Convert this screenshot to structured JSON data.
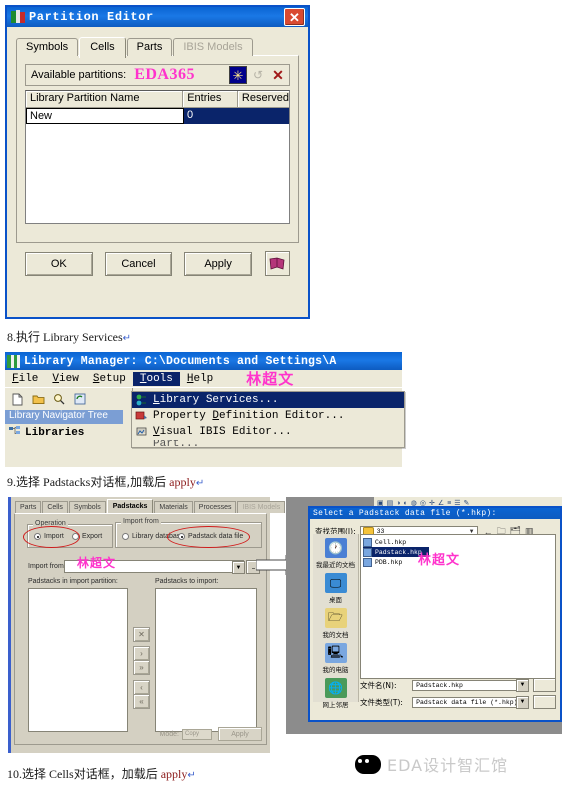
{
  "partition_editor": {
    "title": "Partition Editor",
    "app_icon": "partition-editor-icon",
    "close_label": "✕",
    "tabs": [
      {
        "label": "Symbols",
        "state": "normal"
      },
      {
        "label": "Cells",
        "state": "selected"
      },
      {
        "label": "Parts",
        "state": "normal"
      },
      {
        "label": "IBIS Models",
        "state": "disabled"
      }
    ],
    "available_partitions_label": "Available partitions:",
    "watermark": "EDA365",
    "toolbar": {
      "new_label": "✳",
      "undo_label": "↺",
      "delete_label": "✕"
    },
    "grid": {
      "columns": [
        "Library Partition Name",
        "Entries",
        "Reserved"
      ],
      "rows": [
        {
          "name": "New",
          "entries": "0",
          "reserved": ""
        }
      ]
    },
    "buttons": {
      "ok": "OK",
      "cancel": "Cancel",
      "apply": "Apply",
      "help": "help-book-icon"
    }
  },
  "step8": {
    "number": "8.",
    "cjk": "执行",
    "text": "Library Services",
    "mark": "↵"
  },
  "library_manager": {
    "title": "Library Manager: C:\\Documents and Settings\\A",
    "app_icon": "library-manager-icon",
    "menus": [
      {
        "label": "File",
        "accel": "F",
        "state": "normal"
      },
      {
        "label": "View",
        "accel": "V",
        "state": "normal"
      },
      {
        "label": "Setup",
        "accel": "S",
        "state": "normal"
      },
      {
        "label": "Tools",
        "accel": "T",
        "state": "selected"
      },
      {
        "label": "Help",
        "accel": "H",
        "state": "normal"
      }
    ],
    "watermark": "林超文",
    "toolbar_icons": [
      "new-document-icon",
      "open-folder-icon",
      "search-icon",
      "refresh-icon"
    ],
    "nav_tab": "Library Navigator Tree",
    "tree_root": "Libraries",
    "tools_menu": [
      {
        "label": "Library Services...",
        "accel": "L",
        "icon": "library-services-icon",
        "state": "selected"
      },
      {
        "label": "Property Definition Editor...",
        "accel": "D",
        "icon": "property-definition-icon",
        "state": "normal"
      },
      {
        "label": "Visual IBIS Editor...",
        "accel": "V",
        "icon": "visual-ibis-icon",
        "state": "normal"
      },
      {
        "label": "Part...",
        "accel": "",
        "icon": "part-icon",
        "state": "clipped"
      }
    ]
  },
  "step9": {
    "number": "9.",
    "cjk_a": "选择",
    "text_a": "Padstacks",
    "cjk_b": "对话框,加载后",
    "text_b": "apply",
    "mark": "↵"
  },
  "padstack_dialog": {
    "tabs": [
      {
        "label": "Parts",
        "state": "normal"
      },
      {
        "label": "Cells",
        "state": "normal"
      },
      {
        "label": "Symbols",
        "state": "normal"
      },
      {
        "label": "Padstacks",
        "state": "selected"
      },
      {
        "label": "Materials",
        "state": "normal"
      },
      {
        "label": "Processes",
        "state": "normal"
      },
      {
        "label": "IBIS Models",
        "state": "disabled"
      }
    ],
    "operation": {
      "legend": "Operation",
      "options": [
        {
          "label": "Import",
          "accel": "I",
          "selected": true
        },
        {
          "label": "Export",
          "accel": "E",
          "selected": false
        }
      ]
    },
    "import_from_group": {
      "legend": "Import from",
      "options": [
        {
          "label": "Library database",
          "accel": "L",
          "selected": false
        },
        {
          "label": "Padstack data file",
          "accel": "f",
          "selected": true
        }
      ]
    },
    "import_from_label": "Import from:",
    "import_from_value": "",
    "browse_label": "...",
    "left_list_label": "Padstacks in import partition:",
    "right_list_label": "Padstacks to import:",
    "transfer_buttons": [
      "✕",
      "›",
      "»",
      "‹",
      "«"
    ],
    "mode_label": "Mode:",
    "mode_value": "Copy",
    "apply_label": "Apply",
    "watermark": "林超文"
  },
  "file_dialog": {
    "title": "Select a Padstack data file (*.hkp):",
    "look_in_label": "查找范围(I):",
    "look_in_value": "33",
    "nav_icons": [
      "back-icon",
      "up-one-level-icon",
      "new-folder-icon",
      "views-icon"
    ],
    "places": [
      {
        "label": "我最近的文档",
        "icon": "recent-documents-icon"
      },
      {
        "label": "桌面",
        "icon": "desktop-icon"
      },
      {
        "label": "我的文档",
        "icon": "my-documents-icon"
      },
      {
        "label": "我的电脑",
        "icon": "my-computer-icon"
      },
      {
        "label": "网上邻居",
        "icon": "network-places-icon"
      }
    ],
    "files": [
      {
        "name": "Cell.hkp",
        "selected": false
      },
      {
        "name": "Padstack.hkp",
        "selected": true
      },
      {
        "name": "PDB.hkp",
        "selected": false
      }
    ],
    "filename_label": "文件名(N):",
    "filename_value": "Padstack.hkp",
    "filetype_label": "文件类型(T):",
    "filetype_value": "Padstack data file (*.hkp)",
    "watermark": "林超文"
  },
  "step10": {
    "number": "10.",
    "cjk_a": "选择",
    "text_a": "Cells",
    "cjk_b": "对话框，加载后",
    "text_b": "apply",
    "mark": "↵"
  },
  "wechat_watermark": {
    "icon": "wechat-icon",
    "text": "EDA设计智汇馆"
  },
  "colors": {
    "title_blue": "#0a64d2",
    "selection_blue": "#0a246a",
    "face": "#ece9d8",
    "dialog_face": "#d4d0c2",
    "pink_watermark": "#ff33cc",
    "red_annotation": "#d11a1a"
  }
}
